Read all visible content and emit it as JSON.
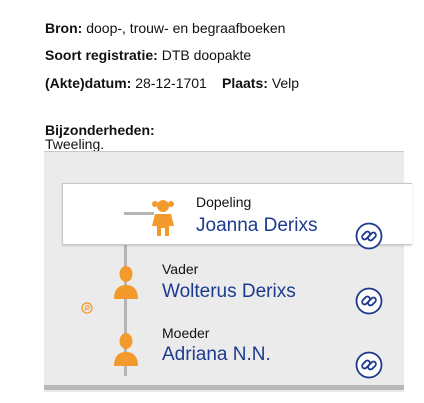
{
  "record": {
    "bron_label": "Bron:",
    "bron_value": "doop-, trouw- en begraafboeken",
    "soort_label": "Soort registratie:",
    "soort_value": "DTB doopakte",
    "datum_label": "(Akte)datum:",
    "datum_value": "28-12-1701",
    "plaats_label": "Plaats:",
    "plaats_value": "Velp",
    "bijzonderheden_label": "Bijzonderheden:",
    "bijzonderheden_value": "Tweeling."
  },
  "persons": [
    {
      "role": "Dopeling",
      "name": "Joanna Derixs",
      "icon": "child-icon"
    },
    {
      "role": "Vader",
      "name": "Wolterus Derixs",
      "icon": "man-icon"
    },
    {
      "role": "Moeder",
      "name": "Adriana N.N.",
      "icon": "woman-icon"
    }
  ],
  "colors": {
    "accent": "#f39a2c",
    "name_link": "#1c3a8f",
    "panel": "#ebebeb"
  }
}
